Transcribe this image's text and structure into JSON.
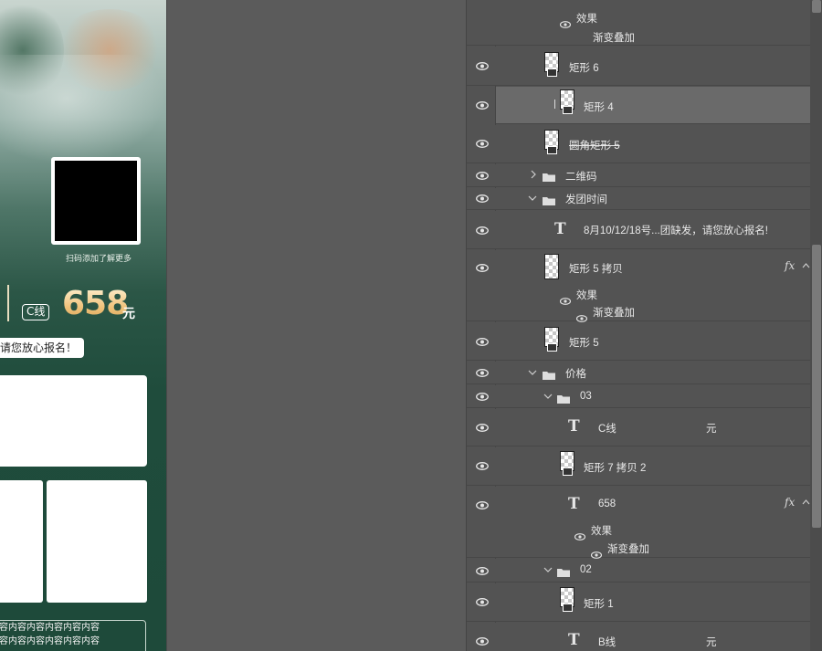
{
  "canvas": {
    "qr_caption": "扫码添加了解更多",
    "price_line_tag": "C线",
    "price_value": "658",
    "price_unit": "元",
    "notice_text": "请您放心报名！",
    "text_lines": [
      "容内容内容内容内容内容",
      "容内容内容内容内容内容"
    ]
  },
  "layers": {
    "top_effect": {
      "label": "效果",
      "sub": "渐变叠加"
    },
    "rect6": "矩形 6",
    "rect4": "矩形 4",
    "rounded_rect5": "圆角矩形 5",
    "group_qr": "二维码",
    "group_time": "发团时间",
    "time_text": "8月10/12/18号...团缺发，请您放心报名!",
    "rect5_copy": "矩形 5 拷贝",
    "rect5_copy_effect": {
      "label": "效果",
      "sub": "渐变叠加"
    },
    "rect5": "矩形 5",
    "group_price": "价格",
    "group_03": "03",
    "cline_text": "C线",
    "cline_unit": "元",
    "rect7_copy2": "矩形 7 拷贝 2",
    "price_658": "658",
    "price_658_effect": {
      "label": "效果",
      "sub": "渐变叠加"
    },
    "group_02": "02",
    "rect1": "矩形 1",
    "bline_text": "B线",
    "bline_unit": "元",
    "fx_label": "fx"
  },
  "icons": {
    "eye": "eye-icon",
    "folder": "folder-icon",
    "type": "T",
    "chevron_right": "›",
    "chevron_down": "⌄"
  },
  "colors": {
    "canvas_green": "#1f4c3c",
    "price_gold": "#f0c27a",
    "panel_bg": "#535353",
    "selected_row": "#6a6a6a",
    "workspace": "#5b5b5b"
  }
}
